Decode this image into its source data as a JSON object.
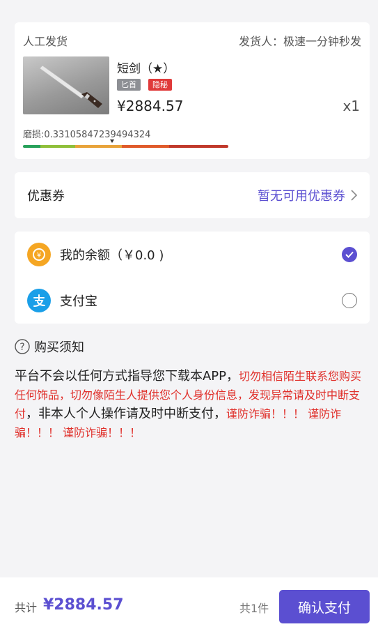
{
  "item": {
    "delivery_type": "人工发货",
    "seller": "发货人：极速一分钟秒发",
    "name": "短剑（★）",
    "tags": [
      "匕首",
      "隐秘"
    ],
    "price": "¥2884.57",
    "quantity": "x1",
    "wear_text": "磨损:0.33105847239494324",
    "wear_value": 0.33105847239494324,
    "wearbar_colors": [
      "#27a15a",
      "#8fbf3a",
      "#e8a33a",
      "#e05a2a",
      "#c0392b"
    ]
  },
  "coupon": {
    "label": "优惠券",
    "value": "暂无可用优惠券"
  },
  "payment": {
    "options": [
      {
        "label": "我的余额（￥0.0 )",
        "selected": true,
        "icon": "balance-icon"
      },
      {
        "label": "支付宝",
        "selected": false,
        "icon": "alipay-icon"
      }
    ]
  },
  "notice": {
    "title": "购买须知",
    "text_1": "平台不会以任何方式指导您下载本APP，",
    "red_1": "切勿相信陌生联系您购买任何饰品，切勿像陌生人提供您个人身份信息，发现异常请及时中断支付",
    "text_2": "，非本人个人操作请及时中断支付，",
    "red_2": "谨防诈骗！！！ 谨防诈骗！！！ 谨防诈骗！！！"
  },
  "footer": {
    "total_label": "共计",
    "total_value": "¥2884.57",
    "count": "共1件",
    "confirm_label": "确认支付"
  },
  "colors": {
    "accent": "#5b4fd1",
    "warning_red": "#e0302b",
    "balance_orange": "#f5a623",
    "alipay_blue": "#1a9fe8"
  }
}
